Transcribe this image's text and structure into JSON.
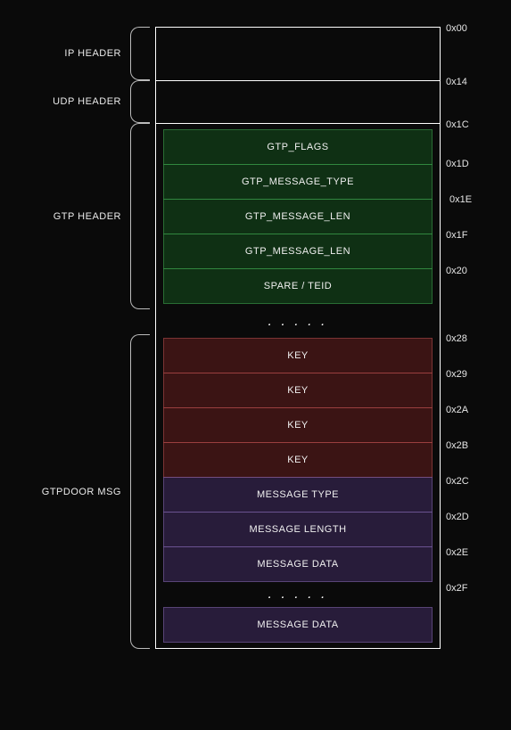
{
  "sections": {
    "ip": {
      "label": "IP HEADER"
    },
    "udp": {
      "label": "UDP HEADER"
    },
    "gtp": {
      "label": "GTP HEADER",
      "fields": [
        "GTP_FLAGS",
        "GTP_MESSAGE_TYPE",
        "GTP_MESSAGE_LEN",
        "GTP_MESSAGE_LEN",
        "SPARE / TEID"
      ]
    },
    "msg": {
      "label": "GTPDOOR  MSG",
      "key_fields": [
        "KEY",
        "KEY",
        "KEY",
        "KEY"
      ],
      "msg_fields": [
        "MESSAGE TYPE",
        "MESSAGE LENGTH",
        "MESSAGE DATA"
      ],
      "tail_field": "MESSAGE DATA"
    }
  },
  "offsets": {
    "ip_start": "0x00",
    "udp_start": "0x14",
    "gtp_start": "0x1C",
    "gtp_1": "0x1D",
    "gtp_2": "0x1E",
    "gtp_3": "0x1F",
    "gtp_4": "0x20",
    "key_0": "0x28",
    "key_1": "0x29",
    "key_2": "0x2A",
    "key_3": "0x2B",
    "msg_0": "0x2C",
    "msg_1": "0x2D",
    "msg_2": "0x2E",
    "msg_3": "0x2F"
  },
  "ellipsis": ". . . . ."
}
